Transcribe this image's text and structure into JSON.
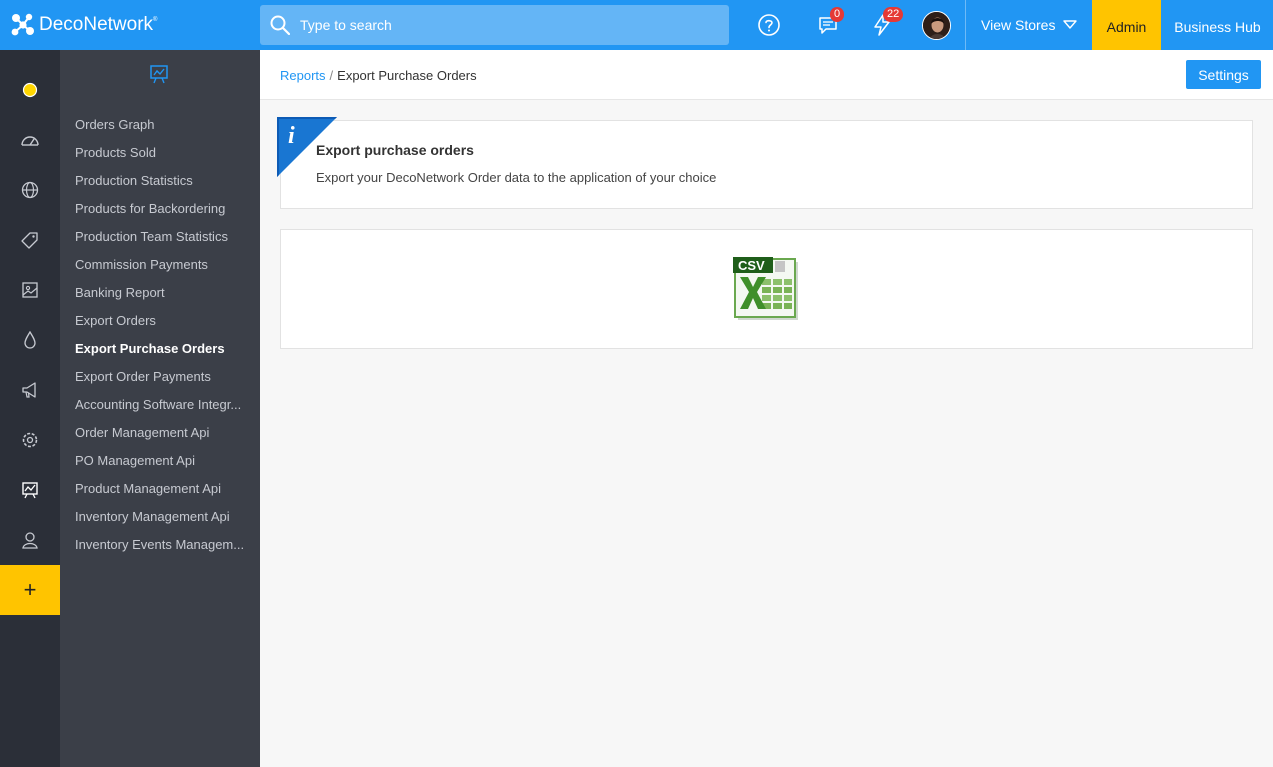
{
  "app": {
    "logo_text": "DecoNetwork",
    "logo_mark": "®"
  },
  "topbar": {
    "search_placeholder": "Type to search",
    "messages_badge": "0",
    "notifications_badge": "22",
    "view_stores_label": "View Stores",
    "admin_label": "Admin",
    "business_hub_label": "Business Hub",
    "colors": {
      "bar": "#2196f3",
      "admin": "#ffc400",
      "badge": "#e53935"
    }
  },
  "rail": {
    "icons": [
      "status-dot-icon",
      "dashboard-icon",
      "globe-icon",
      "tag-icon",
      "image-icon",
      "ink-drop-icon",
      "megaphone-icon",
      "settings-icon",
      "reports-icon",
      "user-icon"
    ],
    "add_label": "+"
  },
  "sidebar": {
    "items": [
      {
        "label": "Orders Graph"
      },
      {
        "label": "Products Sold"
      },
      {
        "label": "Production Statistics"
      },
      {
        "label": "Products for Backordering"
      },
      {
        "label": "Production Team Statistics"
      },
      {
        "label": "Commission Payments"
      },
      {
        "label": "Banking Report"
      },
      {
        "label": "Export Orders"
      },
      {
        "label": "Export Purchase Orders",
        "active": true
      },
      {
        "label": "Export Order Payments"
      },
      {
        "label": "Accounting Software Integr..."
      },
      {
        "label": "Order Management Api"
      },
      {
        "label": "PO Management Api"
      },
      {
        "label": "Product Management Api"
      },
      {
        "label": "Inventory Management Api"
      },
      {
        "label": "Inventory Events Managem..."
      }
    ]
  },
  "breadcrumb": {
    "parent": "Reports",
    "separator": "/",
    "current": "Export Purchase Orders"
  },
  "header": {
    "settings_label": "Settings"
  },
  "info": {
    "icon_letter": "i",
    "title": "Export purchase orders",
    "description": "Export your DecoNetwork Order data to the application of your choice"
  },
  "export": {
    "csv_label": "CSV"
  }
}
